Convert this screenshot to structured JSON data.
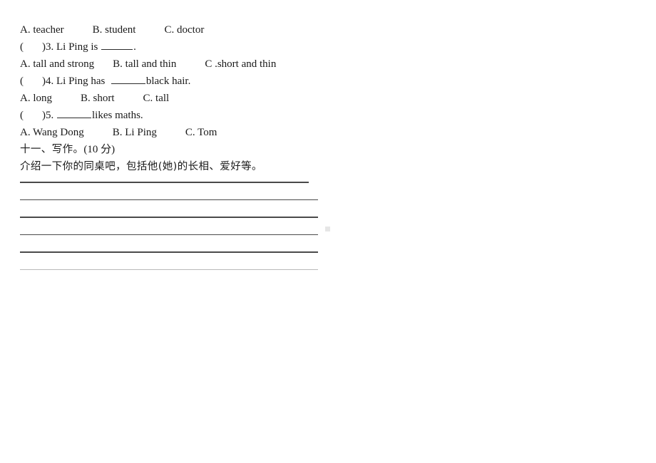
{
  "document": {
    "background_color": "#ffffff",
    "text_color": "#1a1a1a",
    "rule_color": "#4a4a4a",
    "rule_faint_color": "#b9b9b9",
    "marker_color": "#e6e6e6"
  },
  "questions": [
    {
      "id": "q2-options",
      "kind": "options",
      "options": [
        "A. teacher",
        "B. student",
        "C. doctor"
      ]
    },
    {
      "id": "q3-stem",
      "kind": "stem",
      "bracket": "(",
      "bracket_close": ")",
      "number": "3.",
      "text_before": " Li Ping is ",
      "blank": "______",
      "text_after": "."
    },
    {
      "id": "q3-options",
      "kind": "options",
      "options": [
        "A. tall and strong",
        "B. tall and thin",
        "C .short and thin"
      ]
    },
    {
      "id": "q4-stem",
      "kind": "stem",
      "bracket": "(",
      "bracket_close": ")",
      "number": "4.",
      "text_before": " Li Ping has  ",
      "blank": "______",
      "text_after": "black hair."
    },
    {
      "id": "q4-options",
      "kind": "options",
      "options": [
        "A. long",
        "B. short",
        "C. tall"
      ]
    },
    {
      "id": "q5-stem",
      "kind": "stem",
      "bracket": "(",
      "bracket_close": ")",
      "number": "5.",
      "text_before": " ",
      "blank": "______",
      "text_after": "likes maths."
    },
    {
      "id": "q5-options",
      "kind": "options",
      "options": [
        "A. Wang Dong",
        "B. Li Ping",
        "C. Tom"
      ]
    }
  ],
  "writing_section": {
    "heading_cjk": "十一、写作。",
    "heading_score": "(10 分)",
    "prompt": "介绍一下你的同桌吧，包括他(她)的长相、爱好等。",
    "answer_line_count": 6
  }
}
